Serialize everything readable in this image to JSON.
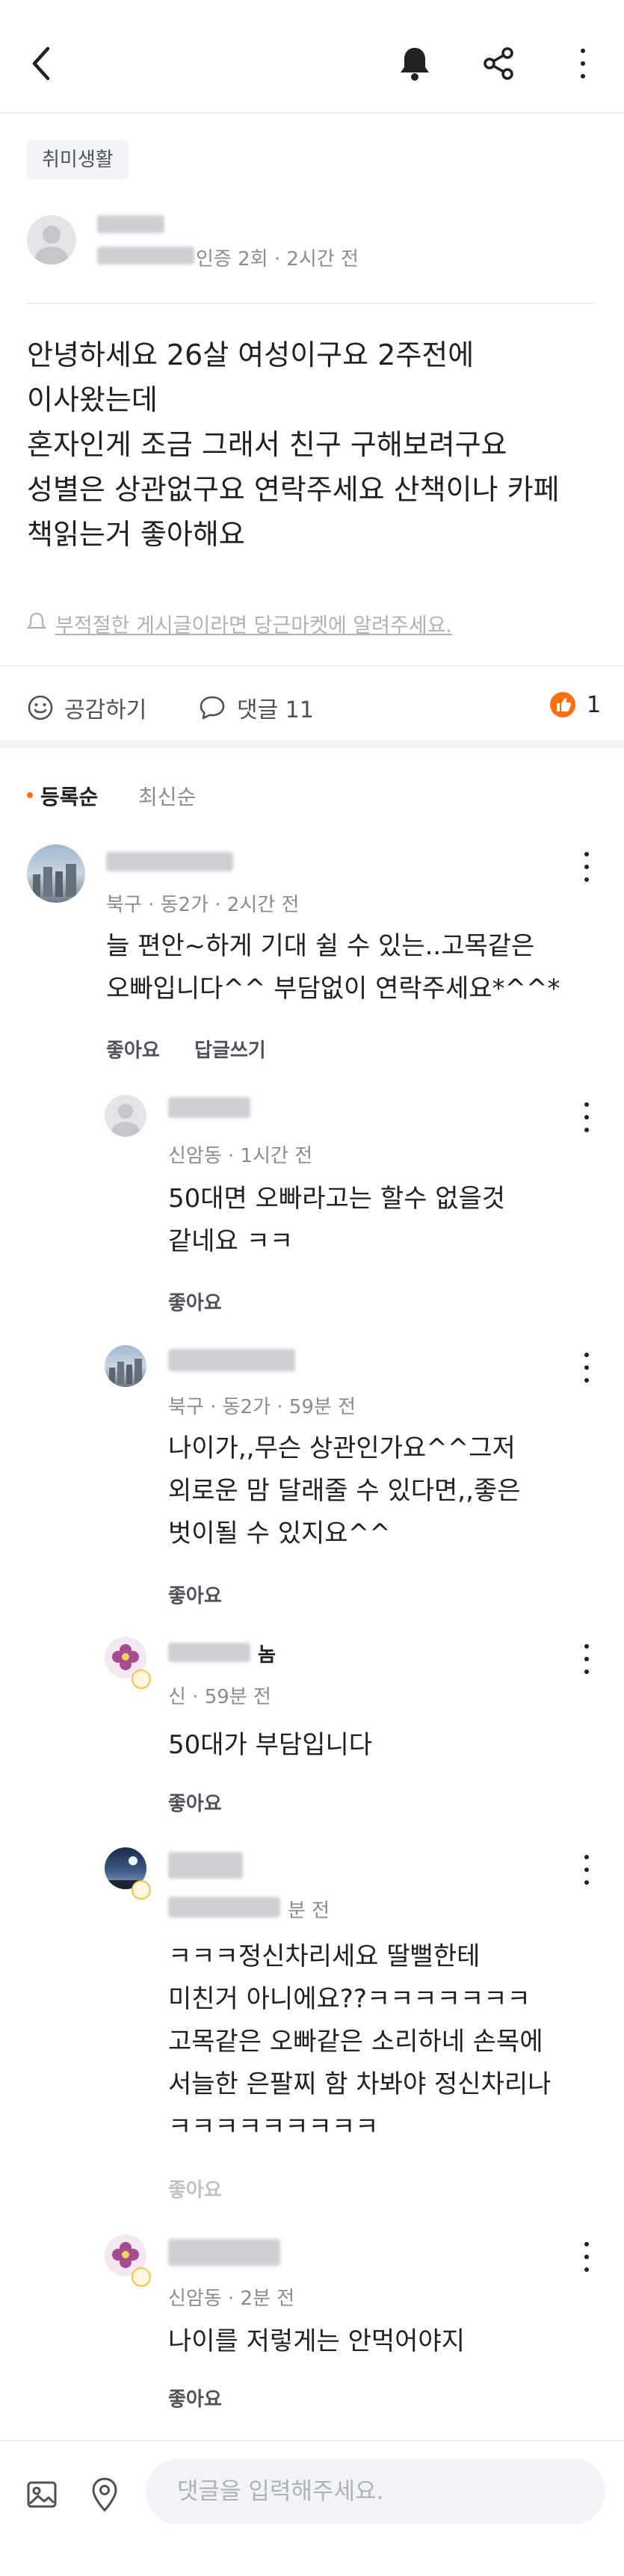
{
  "category": "취미생활",
  "post": {
    "author_meta": "인증 2회 · 2시간 전",
    "body": "안녕하세요 26살 여성이구요 2주전에\n이사왔는데\n혼자인게 조금 그래서 친구 구해보려구요\n성별은 상관없구요 연락주세요 산책이나 카페\n책읽는거 좋아해요",
    "report_text": "부적절한 게시글이라면 당근마켓에 알려주세요."
  },
  "actions": {
    "empathy_label": "공감하기",
    "comment_label": "댓글 11",
    "like_count": "1"
  },
  "sort": {
    "registered": "등록순",
    "latest": "최신순"
  },
  "comments": [
    {
      "meta": "북구 · 동2가 · 2시간 전",
      "text": "늘 편안~하게 기대 쉴 수 있는..고목같은\n오빠입니다^^ 부담없이 연락주세요*^^*",
      "like_label": "좋아요",
      "reply_label": "답글쓰기"
    },
    {
      "meta": "신암동 · 1시간 전",
      "text": "50대면 오빠라고는 할수 없을것\n같네요 ㅋㅋ",
      "like_label": "좋아요"
    },
    {
      "meta": "북구 · 동2가 · 59분 전",
      "text": "나이가,,무슨 상관인가요^^그저\n외로운 맘 달래줄 수 있다면,,좋은\n벗이될 수 있지요^^",
      "like_label": "좋아요"
    },
    {
      "name_fragment": "놈",
      "meta": "신 · 59분 전",
      "text": "50대가 부담입니다",
      "like_label": "좋아요"
    },
    {
      "meta": "분 전",
      "text": "ㅋㅋㅋ정신차리세요 딸뻘한테\n미친거 아니에요??ㅋㅋㅋㅋㅋㅋㅋ\n고목같은 오빠같은 소리하네 손목에\n서늘한 은팔찌 함 차봐야 정신차리나\nㅋㅋㅋㅋㅋㅋㅋㅋㅋ",
      "like_label": "좋아요"
    },
    {
      "meta": "신암동 · 2분 전",
      "text": "나이를 저렇게는 안먹어야지",
      "like_label": "좋아요"
    }
  ],
  "input": {
    "placeholder": "댓글을 입력해주세요."
  },
  "colors": {
    "accent": "#ff6f0f",
    "text": "#212124",
    "secondary": "#868b94"
  }
}
